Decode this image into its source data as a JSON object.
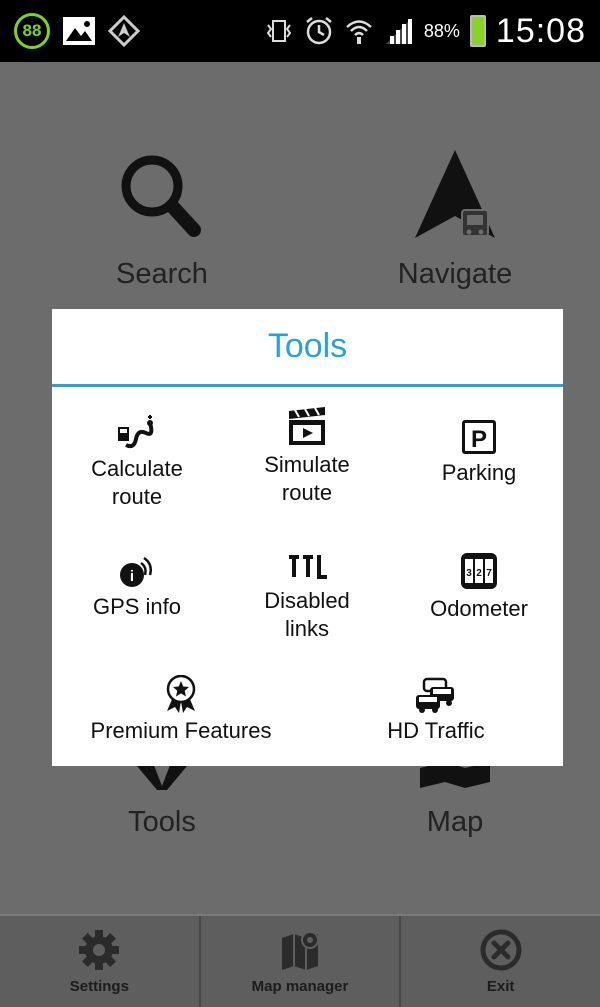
{
  "status_bar": {
    "notification_badge": "88",
    "battery_percent": "88%",
    "time": "15:08",
    "battery_level": 0.88
  },
  "main_menu": {
    "search_label": "Search",
    "navigate_label": "Navigate",
    "tools_label": "Tools",
    "map_label": "Map"
  },
  "dialog": {
    "title": "Tools",
    "accent_color": "#2aa1d9",
    "items": [
      {
        "label": "Calculate\nroute",
        "icon": "calculate-route-icon"
      },
      {
        "label": "Simulate\nroute",
        "icon": "simulate-route-icon"
      },
      {
        "label": "Parking",
        "icon": "parking-icon"
      },
      {
        "label": "GPS info",
        "icon": "gps-info-icon"
      },
      {
        "label": "Disabled\nlinks",
        "icon": "disabled-links-icon"
      },
      {
        "label": "Odometer",
        "icon": "odometer-icon"
      },
      {
        "label": "Premium Features",
        "icon": "premium-features-icon"
      },
      {
        "label": "HD Traffic",
        "icon": "hd-traffic-icon"
      }
    ]
  },
  "bottom_bar": {
    "settings_label": "Settings",
    "map_manager_label": "Map manager",
    "exit_label": "Exit"
  }
}
